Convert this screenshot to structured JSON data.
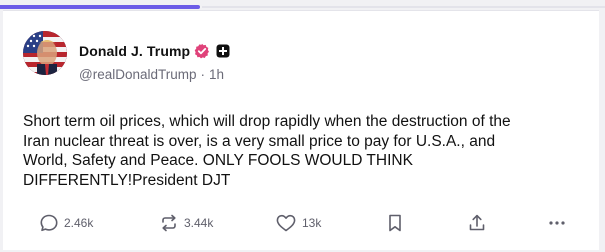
{
  "progress": {
    "fraction": 0.33
  },
  "post": {
    "author": {
      "display_name": "Donald J. Trump",
      "handle": "@realDonaldTrump",
      "separator": "·",
      "time": "1h"
    },
    "text": "Short term oil prices, which will drop rapidly when the destruction of the\nIran nuclear threat is over, is a very small price to pay for U.S.A., and\nWorld, Safety and Peace. ONLY FOOLS WOULD THINK\nDIFFERENTLY!President DJT",
    "actions": {
      "replies": "2.46k",
      "reposts": "3.44k",
      "likes": "13k"
    }
  },
  "colors": {
    "accent": "#6c5ce7",
    "verified_badge": "#e0427a",
    "icon": "#5f5f6b"
  },
  "icons": {
    "verified": "verified-badge-icon",
    "affiliation": "plus-badge-icon",
    "reply": "reply-icon",
    "repost": "repost-icon",
    "like": "heart-icon",
    "bookmark": "bookmark-icon",
    "share": "share-icon",
    "more": "more-icon"
  }
}
